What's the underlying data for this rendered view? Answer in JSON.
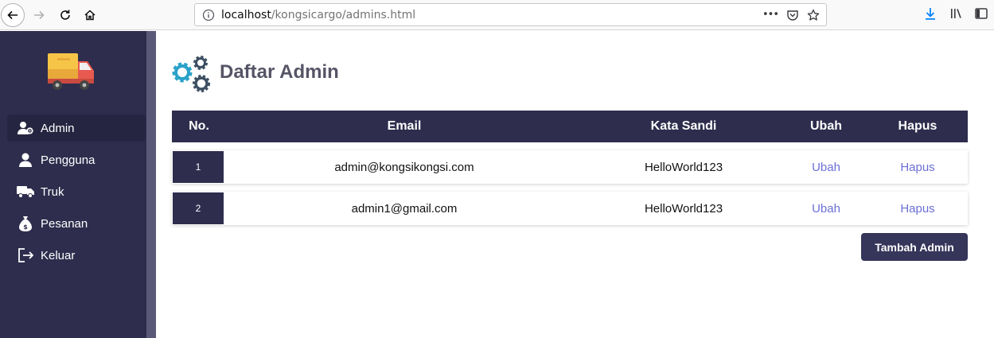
{
  "browser": {
    "url_host": "localhost",
    "url_path": "/kongsicargo/admins.html",
    "url_more_icon": "•••"
  },
  "sidebar": {
    "items": [
      {
        "label": "Admin",
        "icon": "admin-icon",
        "active": true
      },
      {
        "label": "Pengguna",
        "icon": "user-icon",
        "active": false
      },
      {
        "label": "Truk",
        "icon": "truck-icon",
        "active": false
      },
      {
        "label": "Pesanan",
        "icon": "money-bag-icon",
        "active": false
      },
      {
        "label": "Keluar",
        "icon": "logout-icon",
        "active": false
      }
    ]
  },
  "main": {
    "title": "Daftar Admin",
    "table": {
      "headers": {
        "no": "No.",
        "email": "Email",
        "password": "Kata Sandi",
        "edit": "Ubah",
        "delete": "Hapus"
      },
      "rows": [
        {
          "no": "1",
          "email": "admin@kongsikongsi.com",
          "password": "HelloWorld123",
          "edit": "Ubah",
          "delete": "Hapus"
        },
        {
          "no": "2",
          "email": "admin1@gmail.com",
          "password": "HelloWorld123",
          "edit": "Ubah",
          "delete": "Hapus"
        }
      ]
    },
    "add_button": "Tambah Admin"
  },
  "colors": {
    "sidebar_bg": "#2e2d4d",
    "table_header_bg": "#2e2d4d",
    "link": "#6b6fd4",
    "gear_blue": "#2aa2c9",
    "gear_dark": "#3d4f63"
  }
}
